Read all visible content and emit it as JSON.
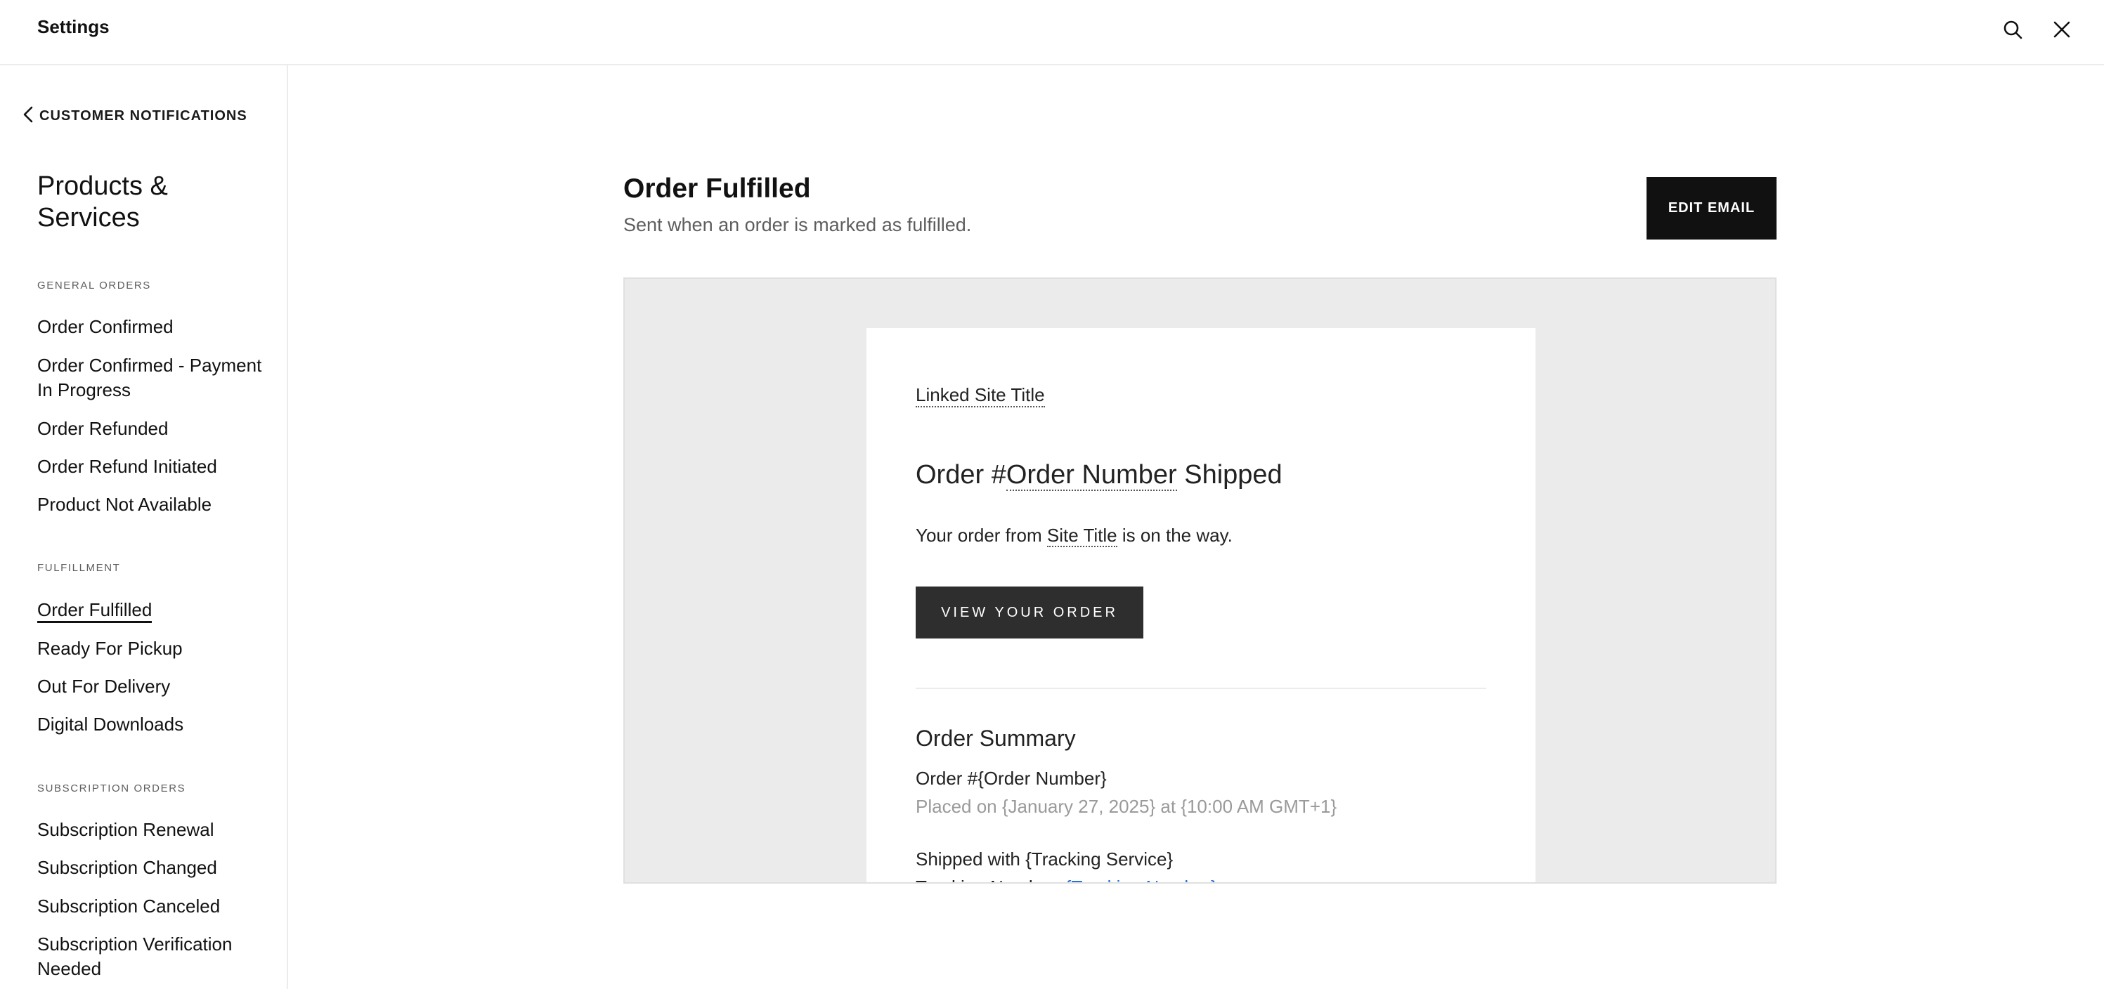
{
  "topbar": {
    "title": "Settings",
    "search_icon": "search-icon",
    "close_icon": "close-icon"
  },
  "sidebar": {
    "back_label": "CUSTOMER NOTIFICATIONS",
    "back_icon": "chevron-left-icon",
    "section_title": "Products & Services",
    "groups": [
      {
        "label": "GENERAL ORDERS",
        "items": [
          "Order Confirmed",
          "Order Confirmed - Payment In Progress",
          "Order Refunded",
          "Order Refund Initiated",
          "Product Not Available"
        ]
      },
      {
        "label": "FULFILLMENT",
        "items": [
          "Order Fulfilled",
          "Ready For Pickup",
          "Out For Delivery",
          "Digital Downloads"
        ]
      },
      {
        "label": "SUBSCRIPTION ORDERS",
        "items": [
          "Subscription Renewal",
          "Subscription Changed",
          "Subscription Canceled",
          "Subscription Verification Needed"
        ]
      }
    ],
    "active_item": "Order Fulfilled"
  },
  "main": {
    "title": "Order Fulfilled",
    "subtitle": "Sent when an order is marked as fulfilled.",
    "edit_button": "EDIT EMAIL"
  },
  "email": {
    "site_title": "Linked Site Title",
    "heading_prefix": "Order #",
    "heading_var": "Order Number",
    "heading_suffix": " Shipped",
    "body_prefix": "Your order from ",
    "body_var": "Site Title",
    "body_suffix": " is on the way.",
    "button": "VIEW YOUR ORDER",
    "summary_title": "Order Summary",
    "order_number": "Order #{Order Number}",
    "placed": "Placed on {January 27, 2025} at {10:00 AM GMT+1}",
    "shipped_prefix": "Shipped with ",
    "shipped_var": "{Tracking Service}",
    "tracking_prefix": "Tracking Number: ",
    "tracking_var": "{Tracking Number}"
  },
  "colors": {
    "accent_dark": "#111111",
    "preview_bg": "#ebebeb",
    "link": "#2a6ed8",
    "muted": "#5e5e5e"
  }
}
